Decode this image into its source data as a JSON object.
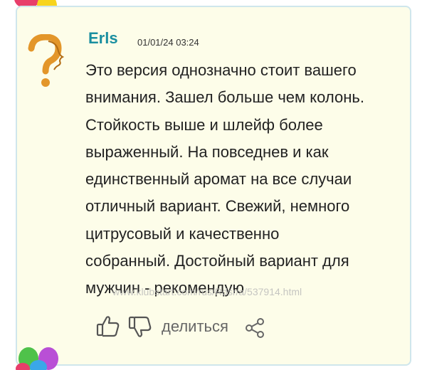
{
  "review": {
    "author": "Erls",
    "date": "01/01/24 03:24",
    "text": "Это версия однозначно стоит вашего\nвнимания. Зашел больше чем колонь.\nСтойкость выше и шлейф более\nвыраженный. На повседнев и как\nединственный аромат на все случаи\nотличный вариант. Свежий, немного\nцитрусовый и качественно\nсобранный. Достойный вариант для\nмужчин - рекомендую",
    "watermark": "www.klubstart.com/rus/Rdsr/a/537914.html"
  },
  "actions": {
    "like_icon": "thumbs-up-icon",
    "dislike_icon": "thumbs-down-icon",
    "share_label": "делиться",
    "share_icon": "share-icon"
  },
  "colors": {
    "card_bg": "#fdfde9",
    "card_border": "#cfe6ec",
    "author": "#1a8fa0",
    "avatar": "#e3962a"
  }
}
